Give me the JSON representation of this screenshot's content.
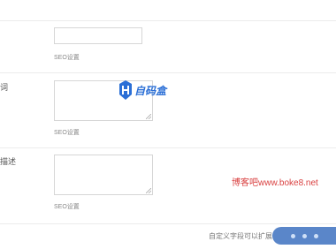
{
  "fields": [
    {
      "label": "",
      "help": "SEO设置"
    },
    {
      "label": "词",
      "help": "SEO设置"
    },
    {
      "label": "描述",
      "help": "SEO设置"
    }
  ],
  "watermark": {
    "text": "自码盒"
  },
  "site_text": "博客吧www.boke8.net",
  "footer": {
    "text": "自定义字段可以扩展"
  }
}
